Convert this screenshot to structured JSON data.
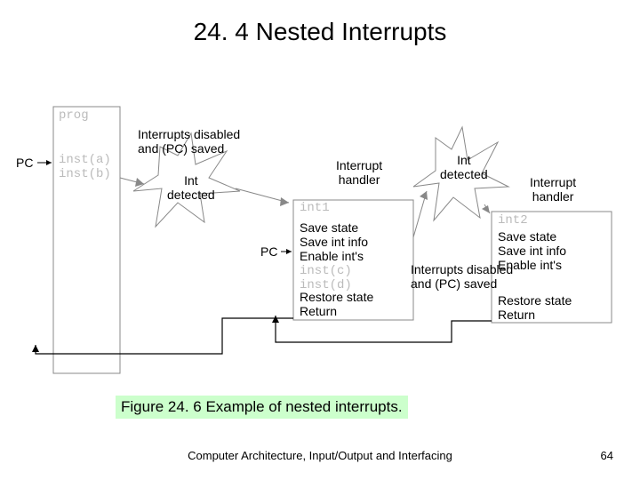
{
  "title": "24. 4    Nested Interrupts",
  "caption": "Figure 24. 6     Example of nested interrupts.",
  "footer": "Computer Architecture, Input/Output and Interfacing",
  "pagenum": "64",
  "labels": {
    "prog": "prog",
    "pc1": "PC",
    "pc2": "PC",
    "inst_ab": "inst(a)\ninst(b)",
    "inst_cd": "inst(c)\ninst(d)",
    "int1": "int1",
    "int2": "int2",
    "disabled1": "Interrupts disabled\nand (PC) saved",
    "disabled2": "Interrupts disabled\nand (PC) saved",
    "detected1": "Int\ndetected",
    "detected2": "Int\ndetected",
    "handler1": "Interrupt\nhandler",
    "handler2": "Interrupt\nhandler",
    "save1": "Save state\nSave int info\nEnable int's",
    "save2": "Save state\nSave int info\nEnable int's",
    "restore1": "Restore state\nReturn",
    "restore2": "Restore state\nReturn"
  }
}
